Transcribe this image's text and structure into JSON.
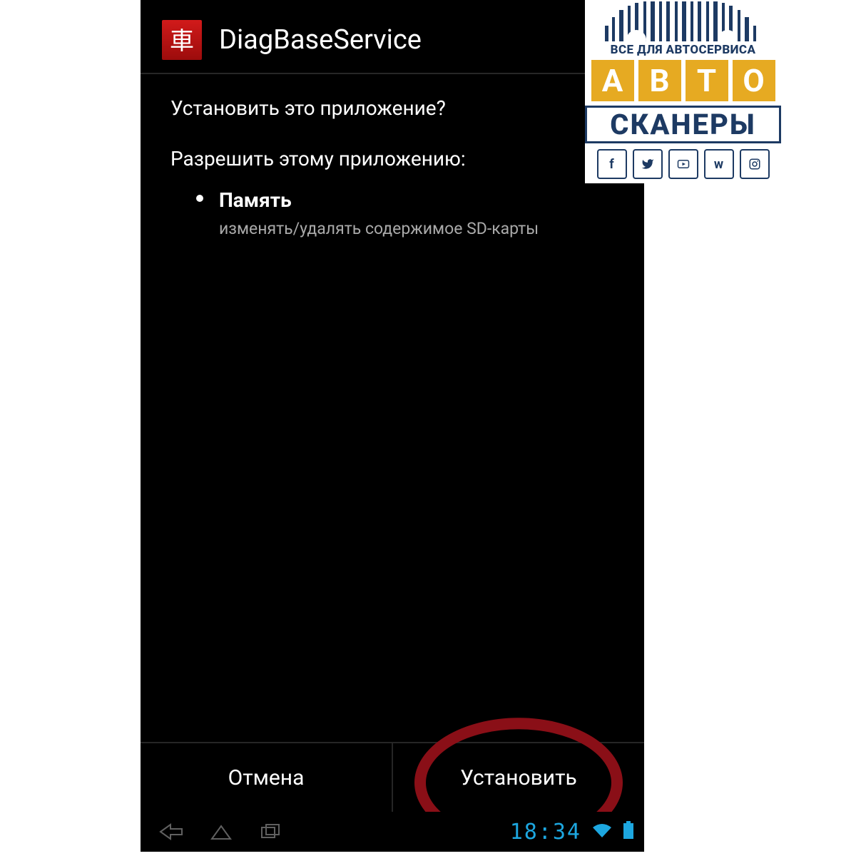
{
  "app": {
    "icon_glyph": "車",
    "title": "DiagBaseService"
  },
  "install": {
    "question": "Установить это приложение?",
    "permissions_title": "Разрешить этому приложению:",
    "permissions": [
      {
        "name": "Память",
        "description": "изменять/удалять содержимое SD-карты"
      }
    ]
  },
  "buttons": {
    "cancel": "Отмена",
    "install": "Установить"
  },
  "statusbar": {
    "time": "18:34"
  },
  "watermark": {
    "tagline": "ВСЕ ДЛЯ АВТОСЕРВИСА",
    "line1_chars": [
      "А",
      "В",
      "Т",
      "О"
    ],
    "line2": "СКАНЕРЫ",
    "social": [
      "f",
      "twitter",
      "youtube",
      "vk",
      "instagram"
    ]
  }
}
